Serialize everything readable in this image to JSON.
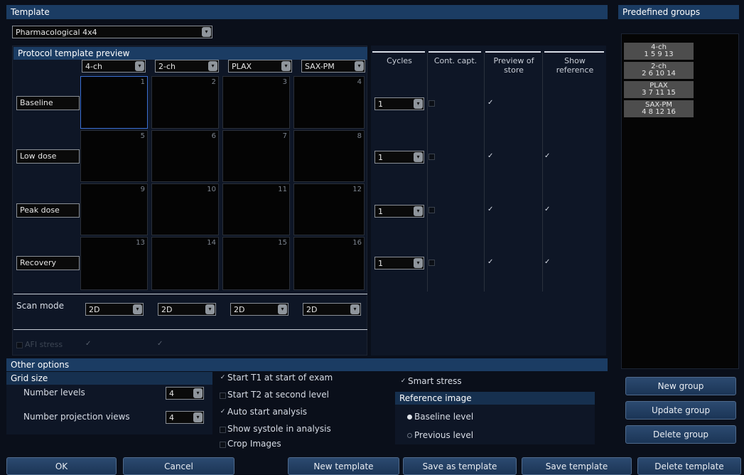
{
  "template": {
    "title": "Template",
    "selected": "Pharmacological 4x4"
  },
  "preview": {
    "title": "Protocol template preview",
    "columns": [
      "4-ch",
      "2-ch",
      "PLAX",
      "SAX-PM"
    ],
    "rows": [
      "Baseline",
      "Low dose",
      "Peak dose",
      "Recovery"
    ],
    "cells": [
      "1",
      "2",
      "3",
      "4",
      "5",
      "6",
      "7",
      "8",
      "9",
      "10",
      "11",
      "12",
      "13",
      "14",
      "15",
      "16"
    ],
    "scan_mode_label": "Scan mode",
    "scan_modes": [
      "2D",
      "2D",
      "2D",
      "2D"
    ],
    "afi_label": "AFI stress",
    "afi_checks": [
      "✓",
      "✓"
    ]
  },
  "settings": {
    "headers": {
      "cycles": "Cycles",
      "cont_capt": "Cont. capt.",
      "preview_line1": "Preview of",
      "preview_line2": "store",
      "show_line1": "Show",
      "show_line2": "reference"
    },
    "rows": [
      {
        "cycles": "1",
        "cont": "",
        "preview": "✓",
        "show": ""
      },
      {
        "cycles": "1",
        "cont": "",
        "preview": "✓",
        "show": "✓"
      },
      {
        "cycles": "1",
        "cont": "",
        "preview": "✓",
        "show": "✓"
      },
      {
        "cycles": "1",
        "cont": "",
        "preview": "✓",
        "show": "✓"
      }
    ]
  },
  "predefined": {
    "title": "Predefined groups",
    "groups": [
      {
        "name": "4-ch",
        "cells": "1 5 9 13"
      },
      {
        "name": "2-ch",
        "cells": "2 6 10 14"
      },
      {
        "name": "PLAX",
        "cells": "3 7 11 15"
      },
      {
        "name": "SAX-PM",
        "cells": "4 8 12 16"
      }
    ],
    "new_group": "New group",
    "update_group": "Update group",
    "delete_group": "Delete group"
  },
  "other": {
    "title": "Other options",
    "grid_title": "Grid size",
    "levels_label": "Number levels",
    "levels_value": "4",
    "views_label": "Number projection views",
    "views_value": "4",
    "options": [
      {
        "label": "Start T1 at start of exam",
        "checked": "✓"
      },
      {
        "label": "Start T2 at second level",
        "checked": ""
      },
      {
        "label": "Auto start analysis",
        "checked": "✓"
      },
      {
        "label": "Show systole in analysis",
        "checked": ""
      },
      {
        "label": "Crop Images",
        "checked": ""
      }
    ],
    "smart_stress": "Smart stress",
    "smart_checked": "✓",
    "ref_title": "Reference image",
    "ref_baseline": "Baseline level",
    "ref_previous": "Previous level"
  },
  "footer": {
    "ok": "OK",
    "cancel": "Cancel",
    "new_template": "New template",
    "save_as_template": "Save as template",
    "save_template": "Save template",
    "delete_template": "Delete template"
  }
}
